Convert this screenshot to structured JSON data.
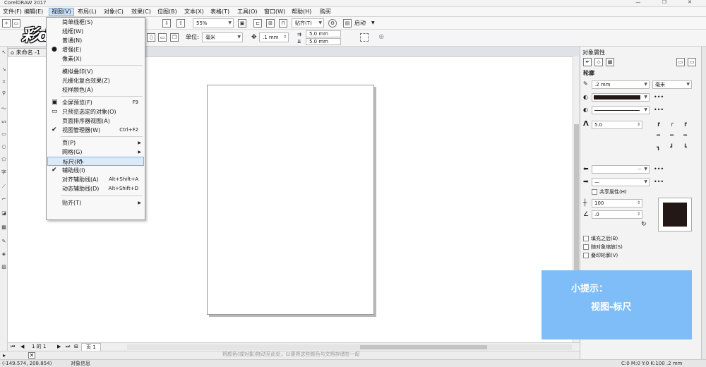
{
  "window": {
    "title": "CorelDRAW 2017",
    "controls": "—  ❐  ✕"
  },
  "menubar": {
    "items": [
      "文件(F)",
      "编辑(E)",
      "视图(V)",
      "布局(L)",
      "对象(C)",
      "效果(C)",
      "位图(B)",
      "文本(X)",
      "表格(T)",
      "工具(O)",
      "窗口(W)",
      "帮助(H)",
      "购买"
    ]
  },
  "toolbar": {
    "zoom": "55%",
    "snap": "贴齐(T)",
    "launch": "启动",
    "unit_label": "单位:",
    "unit": "毫米",
    "nudge": ".1 mm",
    "dup_x": "5.0 mm",
    "dup_y": "5.0 mm"
  },
  "logo": {
    "text": "彩dōng视频"
  },
  "document": {
    "tab": "未命名 -1",
    "page_tab": "页 1",
    "page_nav": "1  的  1"
  },
  "statusbar": {
    "hint": "将颜色(或对象)拖动至此处，以便将这些颜色与文档存储在一起",
    "coords": "(-149.574, 208.854)",
    "info": "对象信息",
    "fill_info": "C:0 M:0 Y:0 K:100  .2 mm"
  },
  "view_menu": {
    "items": [
      {
        "label": "简单线框(S)",
        "shortcut": "",
        "mark": ""
      },
      {
        "label": "线框(W)",
        "shortcut": "",
        "mark": ""
      },
      {
        "label": "普通(N)",
        "shortcut": "",
        "mark": ""
      },
      {
        "label": "增强(E)",
        "shortcut": "",
        "mark": "●"
      },
      {
        "label": "像素(X)",
        "shortcut": "",
        "mark": ""
      },
      {
        "label": "模拟叠印(V)",
        "shortcut": "",
        "mark": ""
      },
      {
        "label": "光栅化复合效果(Z)",
        "shortcut": "",
        "mark": ""
      },
      {
        "label": "校样颜色(A)",
        "shortcut": "",
        "mark": ""
      },
      {
        "label": "全屏预览(F)",
        "shortcut": "F9",
        "mark": "▣"
      },
      {
        "label": "只预览选定的对象(O)",
        "shortcut": "",
        "mark": "▭"
      },
      {
        "label": "页面排序器视图(A)",
        "shortcut": "",
        "mark": ""
      },
      {
        "label": "视图管理器(W)",
        "shortcut": "Ctrl+F2",
        "mark": "✔"
      },
      {
        "label": "页(P)",
        "shortcut": "",
        "mark": "",
        "sub": "▶"
      },
      {
        "label": "网格(G)",
        "shortcut": "",
        "mark": "",
        "sub": "▶"
      },
      {
        "label": "标尺(R)",
        "shortcut": "",
        "mark": ""
      },
      {
        "label": "辅助线(I)",
        "shortcut": "",
        "mark": "✔"
      },
      {
        "label": "对齐辅助线(A)",
        "shortcut": "Alt+Shift+A",
        "mark": ""
      },
      {
        "label": "动态辅助线(D)",
        "shortcut": "Alt+Shift+D",
        "mark": ""
      },
      {
        "label": "贴齐(T)",
        "shortcut": "",
        "mark": "",
        "sub": "▶"
      }
    ]
  },
  "properties": {
    "title": "对象属性",
    "section": "轮廓",
    "width": ".2 mm",
    "unit": "毫米",
    "miter": "5.0",
    "shared_attr": "共享属性(H)",
    "stretch": "100",
    "angle": ".0",
    "checks": [
      "填充之后(B)",
      "随对象缩放(S)",
      "叠印轮廓(V)"
    ],
    "color": "#231815"
  },
  "tip": {
    "line1": "小提示：",
    "line2": "视图-标尺"
  }
}
